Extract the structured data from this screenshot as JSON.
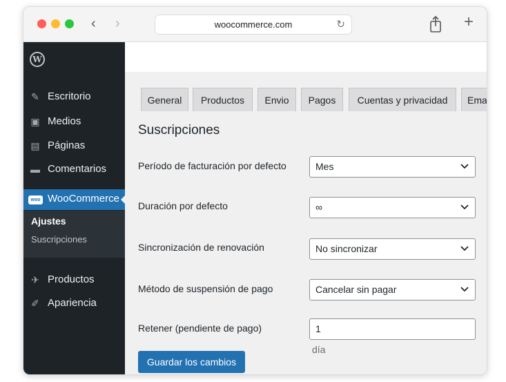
{
  "browser": {
    "url": "woocommerce.com",
    "back_glyph": "‹",
    "forward_glyph": "›",
    "reload_glyph": "↻",
    "new_tab_glyph": "+"
  },
  "sidebar": {
    "logo_glyph": "W",
    "items": [
      {
        "label": "Escritorio",
        "icon": "pin-icon",
        "glyph": "✎"
      },
      {
        "label": "Medios",
        "icon": "media-icon",
        "glyph": "▣"
      },
      {
        "label": "Páginas",
        "icon": "pages-icon",
        "glyph": "▤"
      },
      {
        "label": "Comentarios",
        "icon": "comments-icon",
        "glyph": "▬"
      },
      {
        "label": "WooCommerce",
        "icon": "woo-icon",
        "glyph": "woo"
      },
      {
        "label": "Productos",
        "icon": "products-icon",
        "glyph": "✈"
      },
      {
        "label": "Apariencia",
        "icon": "appearance-icon",
        "glyph": "✐"
      }
    ],
    "submenu": {
      "ajustes": "Ajustes",
      "suscripciones": "Suscripciones"
    }
  },
  "tabs": [
    {
      "label": "General"
    },
    {
      "label": "Productos"
    },
    {
      "label": "Envio"
    },
    {
      "label": "Pagos"
    },
    {
      "label": "Cuentas y privacidad"
    },
    {
      "label": "Ema"
    }
  ],
  "main": {
    "heading": "Suscripciones",
    "fields": [
      {
        "label": "Período de facturación por defecto",
        "value": "Mes"
      },
      {
        "label": "Duración por defecto",
        "value": "∞"
      },
      {
        "label": "Sincronización de renovación",
        "value": "No sincronizar"
      },
      {
        "label": "Método de suspensión de pago",
        "value": "Cancelar sin pagar"
      }
    ],
    "retain": {
      "label": "Retener (pendiente de pago)",
      "value": "1",
      "hint": "día"
    },
    "save_label": "Guardar los cambios"
  },
  "colors": {
    "accent": "#2271b1",
    "sidebar_bg": "#1d2327"
  }
}
